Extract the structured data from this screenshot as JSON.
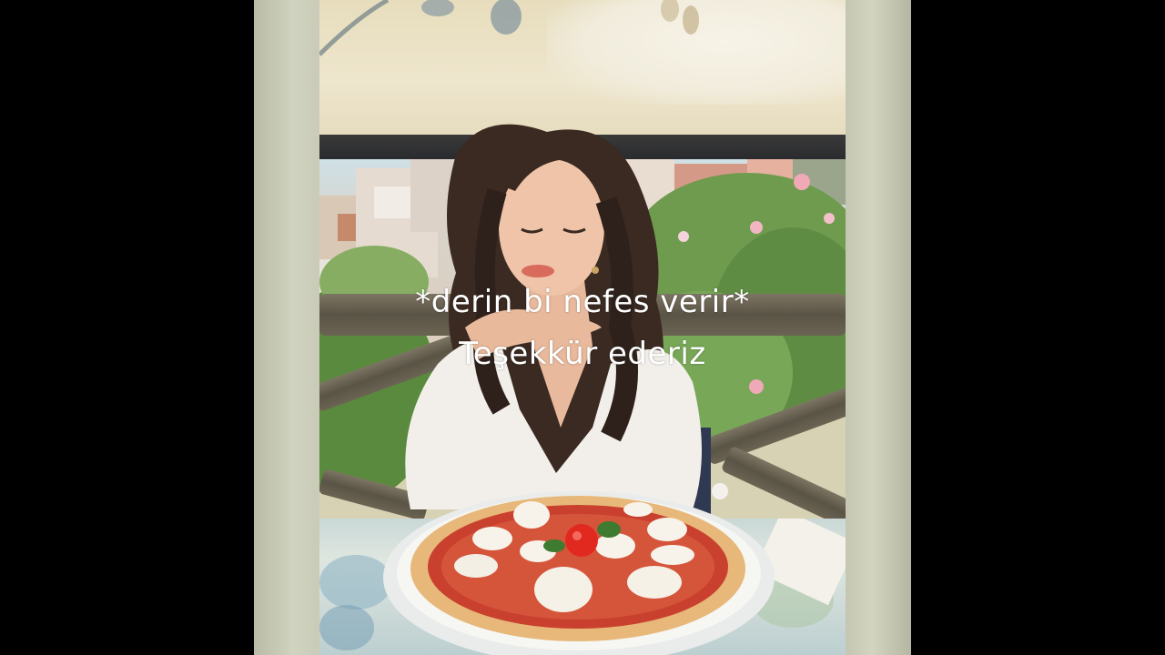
{
  "captions": {
    "line1": "*derin bi nefes verir*",
    "line2": "Teşekkür ederiz"
  },
  "colors": {
    "letterbox": "#000000",
    "frame": "#c6c8b4",
    "caption_text": "#ffffff"
  }
}
